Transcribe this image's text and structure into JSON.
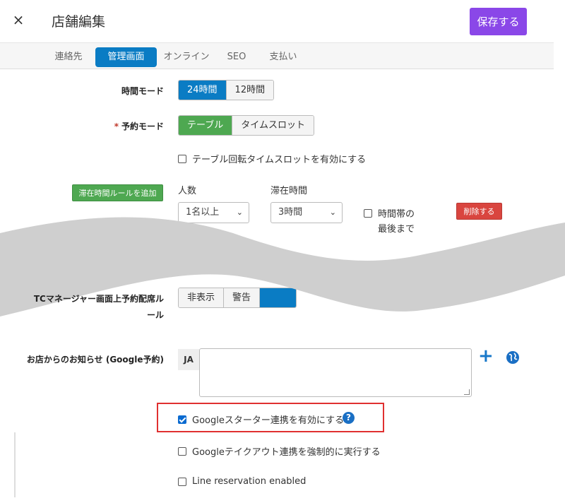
{
  "header": {
    "close_glyph": "×",
    "title": "店舗編集",
    "save_label": "保存する"
  },
  "tabs": [
    {
      "label": "連絡先",
      "active": false
    },
    {
      "label": "管理画面",
      "active": true
    },
    {
      "label": "オンライン",
      "active": false
    },
    {
      "label": "SEO",
      "active": false
    },
    {
      "label": "支払い",
      "active": false
    }
  ],
  "time_mode": {
    "label": "時間モード",
    "options": [
      "24時間",
      "12時間"
    ],
    "selected": "24時間"
  },
  "reservation_mode": {
    "required_mark": "*",
    "label": "予約モード",
    "options": [
      "テーブル",
      "タイムスロット"
    ],
    "selected": "テーブル",
    "rotation_checkbox": "テーブル回転タイムスロットを有効にする"
  },
  "stay_rule": {
    "add_button": "滞在時間ルールを追加",
    "people_label": "人数",
    "people_value": "1名以上",
    "duration_label": "滞在時間",
    "duration_value": "3時間",
    "until_end_label_1": "時間帯の",
    "until_end_label_2": "最後まで",
    "delete_button": "削除する"
  },
  "tc_manager": {
    "label_1": "TCマネージャー画面上予約配席ル",
    "label_2": "ール",
    "options": [
      "非表示",
      "警告"
    ]
  },
  "notice": {
    "label": "お店からのお知らせ (Google予約)",
    "lang": "JA",
    "value": ""
  },
  "checkboxes": {
    "google_starter": {
      "label": "Googleスターター連携を有効にする",
      "checked": true
    },
    "google_takeout": {
      "label": "Googleテイクアウト連携を強制的に実行する",
      "checked": false
    },
    "line_reservation": {
      "label": "Line reservation enabled",
      "checked": false
    }
  },
  "colors": {
    "accent_purple": "#8a47e8",
    "active_blue": "#0a7cc4",
    "green": "#4ea851",
    "danger_red": "#d9453f",
    "highlight_frame": "#e03030"
  },
  "icons": {
    "plus": "plus-icon",
    "globe": "globe-icon",
    "help": "help-circle-icon",
    "close": "close-icon"
  },
  "help_glyph": "?",
  "plus_glyph": "+",
  "chevron_glyph": "⌄"
}
